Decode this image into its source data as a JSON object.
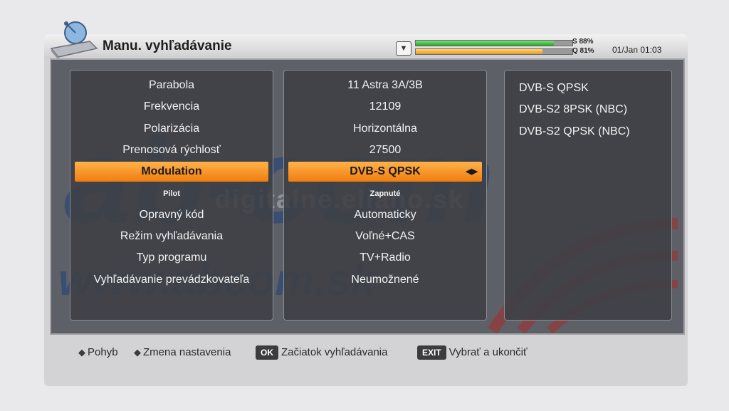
{
  "header": {
    "title": "Manu. vyhľadávanie",
    "signal_s_label": "S 88%",
    "signal_q_label": "Q 81%",
    "signal_s_value": 88,
    "signal_q_value": 81,
    "datetime": "01/Jan 01:03"
  },
  "settings": [
    {
      "label": "Parabola",
      "value": "11 Astra 3A/3B"
    },
    {
      "label": "Frekvencia",
      "value": "12109"
    },
    {
      "label": "Polarizácia",
      "value": "Horizontálna"
    },
    {
      "label": "Prenosová rýchlosť",
      "value": "27500"
    },
    {
      "label": "Modulation",
      "value": "DVB-S QPSK",
      "selected": true
    },
    {
      "label": "Pilot",
      "value": "Zapnuté"
    },
    {
      "label": "Opravný kód",
      "value": "Automaticky"
    },
    {
      "label": "Režim vyhľadávania",
      "value": "Voľné+CAS"
    },
    {
      "label": "Typ programu",
      "value": "TV+Radio"
    },
    {
      "label": "Vyhľadávanie prevádzkovateľa",
      "value": "Neumožnené"
    }
  ],
  "modulation_options": [
    "DVB-S QPSK",
    "DVB-S2 8PSK (NBC)",
    "DVB-S2 QPSK (NBC)"
  ],
  "watermark": {
    "logo": "ab-com",
    "site": "digitalne.eliano.sk",
    "url": "www.abcom.sk"
  },
  "footer": {
    "move_label": "Pohyb",
    "change_label": "Zmena nastavenia",
    "ok_key": "OK",
    "ok_label": "Začiatok vyhľadávania",
    "exit_key": "EXIT",
    "exit_label": "Vybrať a ukončiť"
  },
  "colors": {
    "selection": "#f07d0e",
    "panel": "#3e4046",
    "watermark_blue": "#1d3f7a",
    "watermark_red": "#a0302e"
  }
}
